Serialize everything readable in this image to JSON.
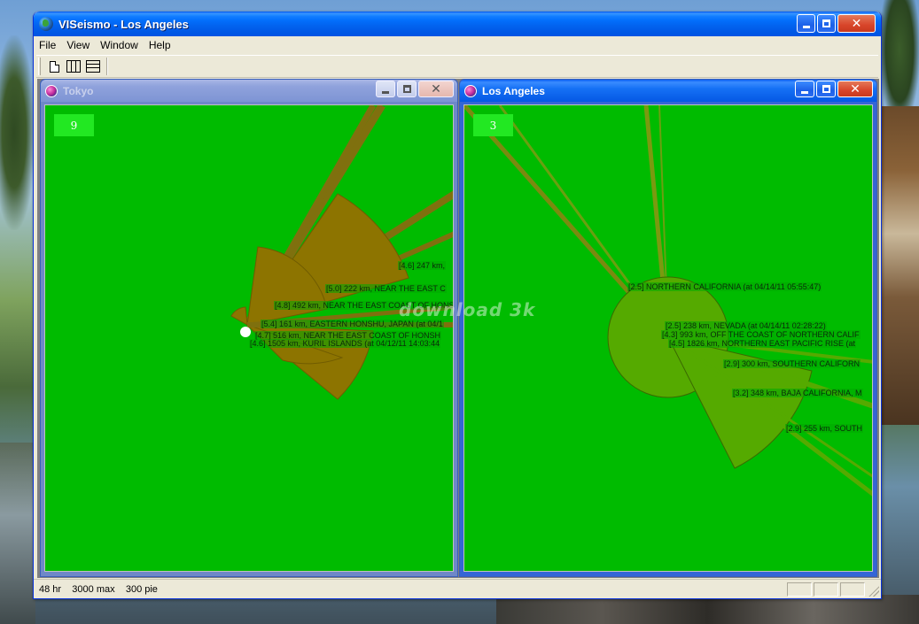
{
  "app": {
    "title": "VISeismo - Los Angeles",
    "menu": [
      "File",
      "View",
      "Window",
      "Help"
    ],
    "toolbar": [
      "new-document-icon",
      "tile-vertical-icon",
      "tile-horizontal-icon"
    ]
  },
  "windows": {
    "tokyo": {
      "title": "Tokyo",
      "count": "9",
      "labels": [
        "[4.6] 247 km,",
        "[5.0] 222 km,  NEAR THE EAST C",
        "[4.8] 492 km,  NEAR THE EAST COAST OF HONSH",
        "[5.4] 161 km,  EASTERN HONSHU, JAPAN (at 04/1",
        "[4.7] 516 km,  NEAR THE EAST COAST OF HONSH",
        "[4.6] 1505 km,  KURIL ISLANDS (at 04/12/11 14:03:44"
      ]
    },
    "la": {
      "title": "Los Angeles",
      "count": "3",
      "labels": [
        "[2.5] NORTHERN CALIFORNIA (at 04/14/11 05:55:47)",
        "[2.5] 238 km,  NEVADA (at 04/14/11 02:28:22)",
        "[4.3] 993 km,  OFF THE COAST OF NORTHERN CALIF",
        "[4.5] 1826 km,  NORTHERN EAST PACIFIC RISE (at",
        "[2.9] 300 km,  SOUTHERN CALIFORN",
        "[3.2] 348 km,  BAJA CALIFORNIA, M",
        "[2.9] 255 km,  SOUTH"
      ]
    }
  },
  "status": {
    "text": "48 hr    3000 max    300 pie"
  },
  "watermark": "download 3k",
  "colors": {
    "canvas": "#00bb00",
    "tokyo_pie": "#9a6e00",
    "la_pie": "#55aa00"
  }
}
